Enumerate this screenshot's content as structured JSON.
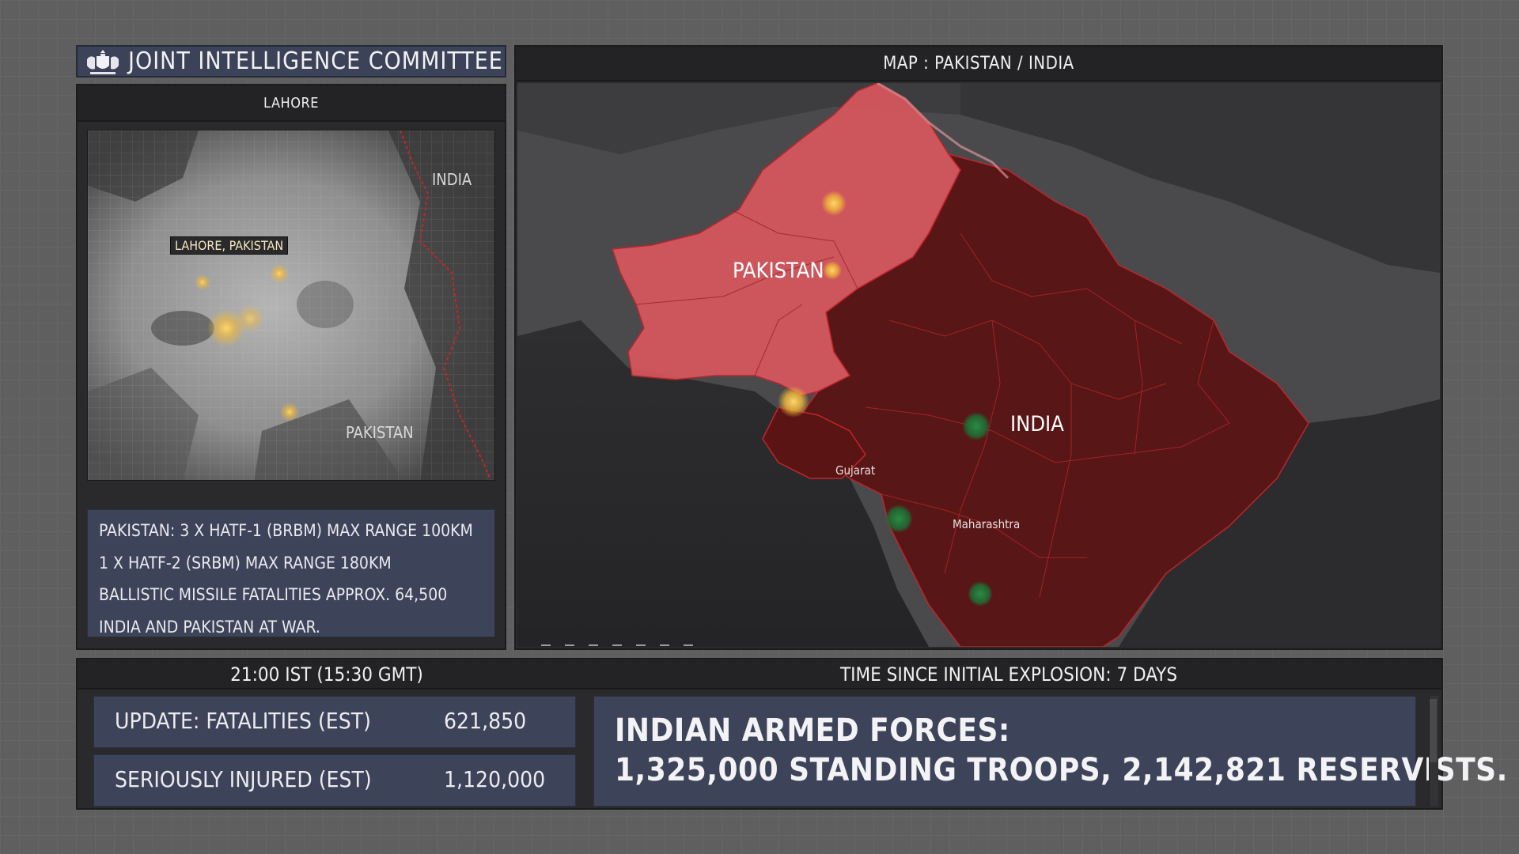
{
  "header": {
    "title": "JOINT INTELLIGENCE COMMITTEE",
    "crest_icon": "royal-crest-icon"
  },
  "lahore_panel": {
    "title": "LAHORE",
    "map": {
      "label_city": "LAHORE, PAKISTAN",
      "label_india": "INDIA",
      "label_pakistan": "PAKISTAN"
    },
    "info_lines": [
      "PAKISTAN:  3 X HATF-1 (BRBM) MAX RANGE 100KM",
      "1 X HATF-2 (SRBM) MAX RANGE 180KM",
      "BALLISTIC MISSILE FATALITIES APPROX. 64,500",
      "INDIA AND PAKISTAN AT WAR."
    ]
  },
  "map_panel": {
    "title": "MAP : PAKISTAN / INDIA",
    "labels": {
      "pakistan": "PAKISTAN",
      "india": "INDIA",
      "gujarat": "Gujarat",
      "maharashtra": "Maharashtra"
    }
  },
  "bottom_panel": {
    "time": "21:00 IST (15:30 GMT)",
    "time_since": "TIME SINCE INITIAL EXPLOSION: 7 DAYS",
    "fatalities": {
      "label": "UPDATE: FATALITIES (EST)",
      "value": "621,850"
    },
    "injured": {
      "label": "SERIOUSLY INJURED (EST)",
      "value": "1,120,000"
    },
    "forces": {
      "line1": "INDIAN ARMED FORCES:",
      "line2": "1,325,000 STANDING TROOPS, 2,142,821 RESERVISTS."
    }
  },
  "colors": {
    "panel_blue": "#3d4359",
    "pakistan_fill": "#d9565e",
    "india_fill": "#5a1414",
    "border_red": "#c0262b",
    "strike_marker": "#f0b83a",
    "indian_base_marker": "#1f6b34"
  }
}
